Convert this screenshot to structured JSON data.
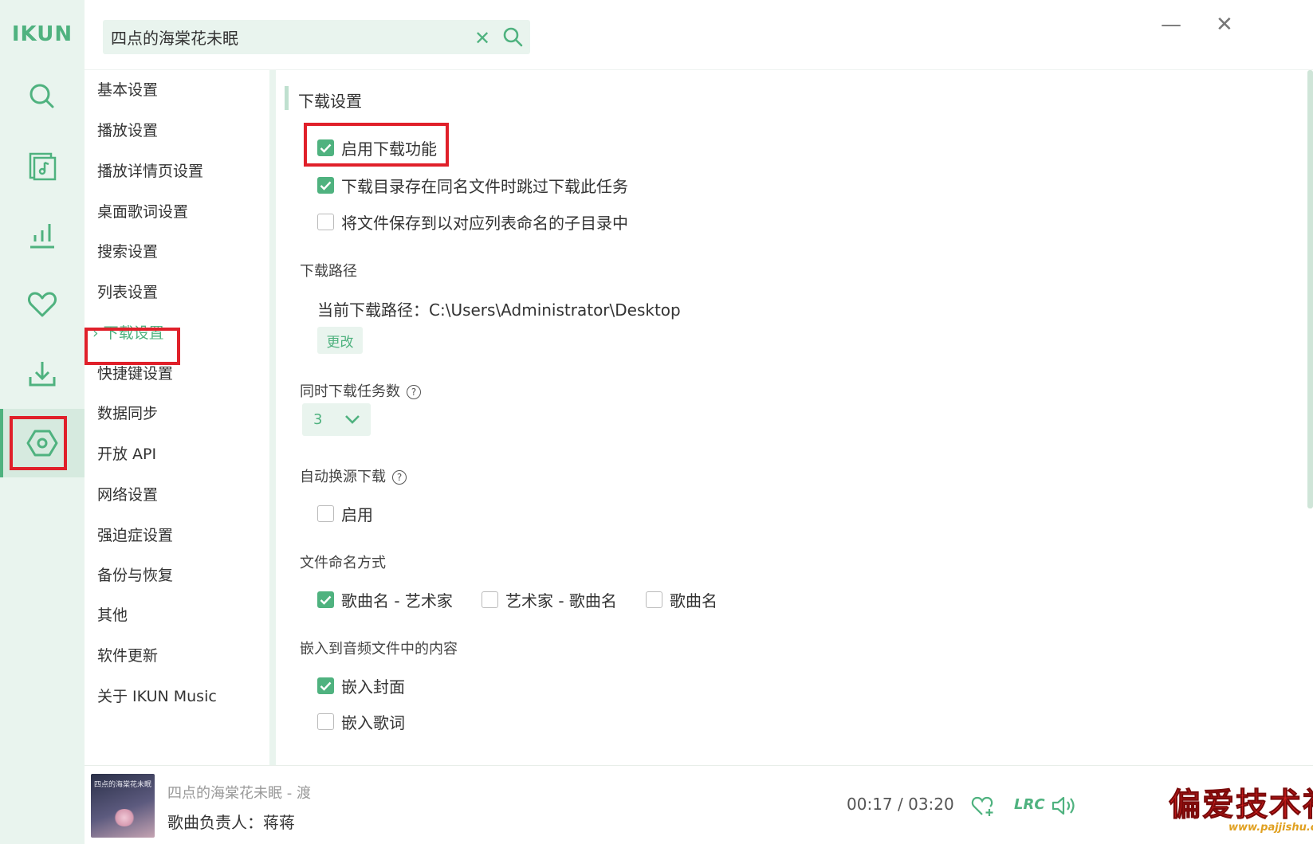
{
  "app": {
    "logo": "IKUN"
  },
  "search": {
    "value": "四点的海棠花未眠"
  },
  "rail": {
    "items": [
      {
        "icon": "search-icon"
      },
      {
        "icon": "music-library-icon"
      },
      {
        "icon": "chart-icon"
      },
      {
        "icon": "heart-icon"
      },
      {
        "icon": "download-icon"
      },
      {
        "icon": "settings-icon",
        "active": true
      }
    ]
  },
  "nav": {
    "items": [
      {
        "label": "基本设置"
      },
      {
        "label": "播放设置"
      },
      {
        "label": "播放详情页设置"
      },
      {
        "label": "桌面歌词设置"
      },
      {
        "label": "搜索设置"
      },
      {
        "label": "列表设置"
      },
      {
        "label": "下载设置",
        "active": true
      },
      {
        "label": "快捷键设置"
      },
      {
        "label": "数据同步"
      },
      {
        "label": "开放 API"
      },
      {
        "label": "网络设置"
      },
      {
        "label": "强迫症设置"
      },
      {
        "label": "备份与恢复"
      },
      {
        "label": "其他"
      },
      {
        "label": "软件更新"
      },
      {
        "label": "关于 IKUN Music"
      }
    ],
    "active_marker": "›"
  },
  "settings": {
    "section_title": "下载设置",
    "enable_download": {
      "label": "启用下载功能",
      "checked": true
    },
    "skip_existing": {
      "label": "下载目录存在同名文件时跳过下载此任务",
      "checked": true
    },
    "save_subdir": {
      "label": "将文件保存到以对应列表命名的子目录中",
      "checked": false
    },
    "path": {
      "heading": "下载路径",
      "current": "当前下载路径：C:\\Users\\Administrator\\Desktop",
      "change_label": "更改"
    },
    "concurrent": {
      "heading": "同时下载任务数",
      "help": "?",
      "value": "3"
    },
    "auto_source": {
      "heading": "自动换源下载",
      "help": "?",
      "enable_label": "启用",
      "checked": false
    },
    "naming": {
      "heading": "文件命名方式",
      "options": [
        {
          "label": "歌曲名 - 艺术家",
          "checked": true
        },
        {
          "label": "艺术家 - 歌曲名",
          "checked": false
        },
        {
          "label": "歌曲名",
          "checked": false
        }
      ]
    },
    "embed": {
      "heading": "嵌入到音频文件中的内容",
      "cover": {
        "label": "嵌入封面",
        "checked": true
      },
      "lyrics": {
        "label": "嵌入歌词",
        "checked": false
      }
    }
  },
  "player": {
    "cover_text": "四点的海棠花未眠",
    "title": "四点的海棠花未眠 - 渡",
    "owner": "歌曲负责人：蒋蒋",
    "time": "00:17 / 03:20",
    "lrc_label": "LRC"
  },
  "watermark": {
    "text": "偏爱技术社区",
    "url": "www.pajjishu.com"
  },
  "colors": {
    "accent": "#4fb27f",
    "rail_bg": "#e9f4ee",
    "highlight": "#e0202a"
  }
}
